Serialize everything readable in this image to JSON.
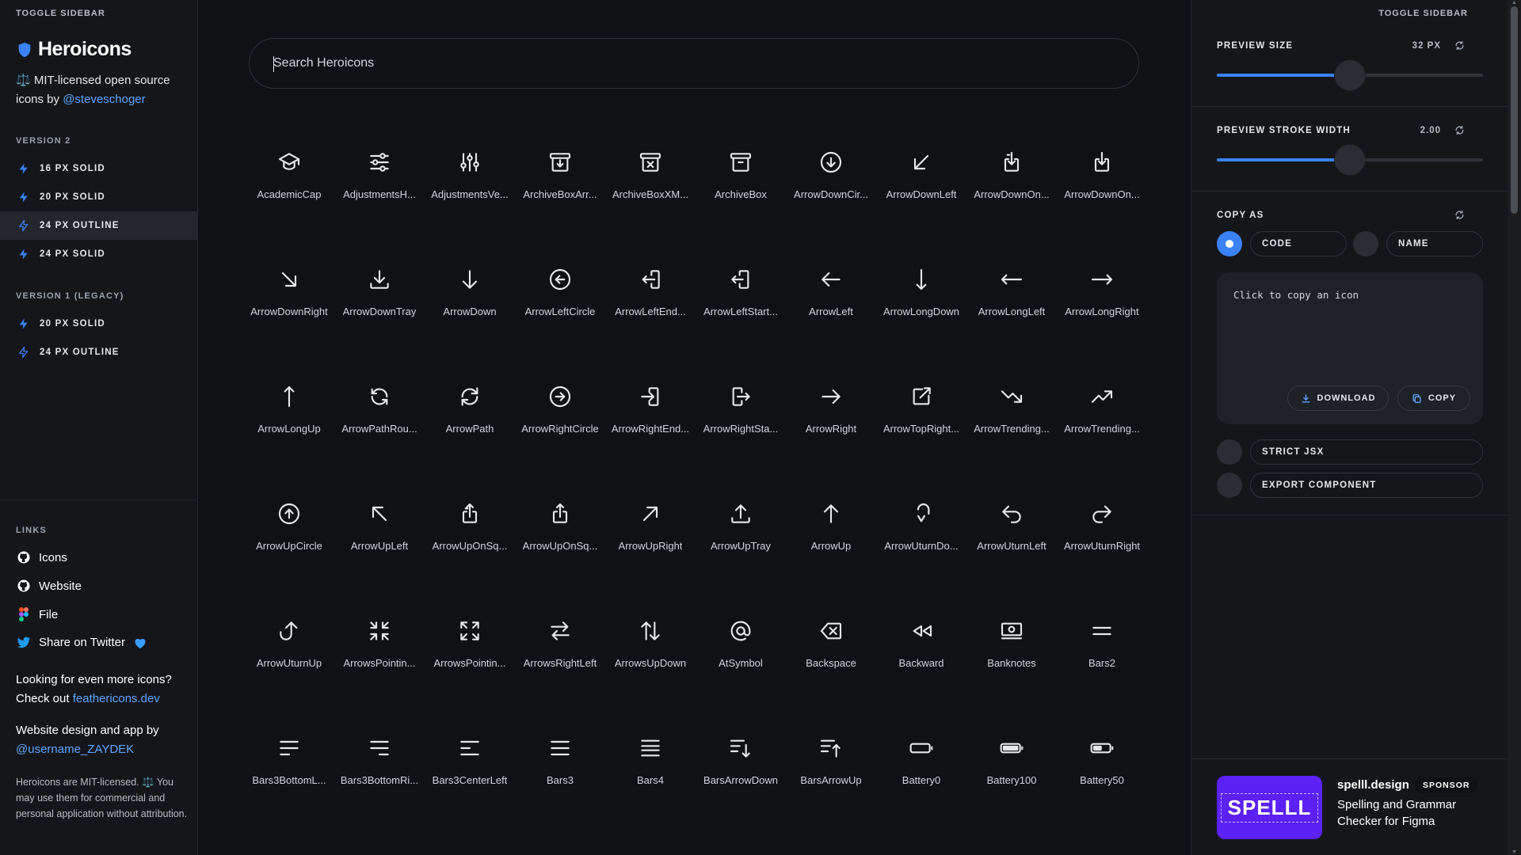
{
  "sidebar": {
    "toggle": "TOGGLE SIDEBAR",
    "brand": "Heroicons",
    "tagline_prefix": "⚖️ MIT-licensed open source icons by ",
    "tagline_link": "@steveschoger",
    "v2_label": "VERSION 2",
    "v2_items": [
      "16 PX SOLID",
      "20 PX SOLID",
      "24 PX OUTLINE",
      "24 PX SOLID"
    ],
    "v1_label": "VERSION 1 (LEGACY)",
    "v1_items": [
      "20 PX SOLID",
      "24 PX OUTLINE"
    ],
    "links_label": "LINKS",
    "links": [
      "Icons",
      "Website",
      "File",
      "Share on Twitter"
    ],
    "promo1_prefix": "Looking for even more icons? Check out ",
    "promo1_link": "feathericons.dev",
    "promo2_prefix": "Website design and app by ",
    "promo2_link": "@username_ZAYDEK",
    "license": "Heroicons are MIT-licensed. ⚖️ You may use them for commercial and personal application without attribution."
  },
  "search": {
    "placeholder": "Search Heroicons"
  },
  "icons": [
    "AcademicCap",
    "AdjustmentsH...",
    "AdjustmentsVe...",
    "ArchiveBoxArr...",
    "ArchiveBoxXM...",
    "ArchiveBox",
    "ArrowDownCir...",
    "ArrowDownLeft",
    "ArrowDownOn...",
    "ArrowDownOn...",
    "ArrowDownRight",
    "ArrowDownTray",
    "ArrowDown",
    "ArrowLeftCircle",
    "ArrowLeftEnd...",
    "ArrowLeftStart...",
    "ArrowLeft",
    "ArrowLongDown",
    "ArrowLongLeft",
    "ArrowLongRight",
    "ArrowLongUp",
    "ArrowPathRou...",
    "ArrowPath",
    "ArrowRightCircle",
    "ArrowRightEnd...",
    "ArrowRightSta...",
    "ArrowRight",
    "ArrowTopRight...",
    "ArrowTrending...",
    "ArrowTrending...",
    "ArrowUpCircle",
    "ArrowUpLeft",
    "ArrowUpOnSq...",
    "ArrowUpOnSq...",
    "ArrowUpRight",
    "ArrowUpTray",
    "ArrowUp",
    "ArrowUturnDo...",
    "ArrowUturnLeft",
    "ArrowUturnRight",
    "ArrowUturnUp",
    "ArrowsPointin...",
    "ArrowsPointin...",
    "ArrowsRightLeft",
    "ArrowsUpDown",
    "AtSymbol",
    "Backspace",
    "Backward",
    "Banknotes",
    "Bars2",
    "Bars3BottomL...",
    "Bars3BottomRi...",
    "Bars3CenterLeft",
    "Bars3",
    "Bars4",
    "BarsArrowDown",
    "BarsArrowUp",
    "Battery0",
    "Battery100",
    "Battery50"
  ],
  "icon_names": [
    "academic-cap-icon",
    "adjustments-horizontal-icon",
    "adjustments-vertical-icon",
    "archive-box-arrow-down-icon",
    "archive-box-x-mark-icon",
    "archive-box-icon",
    "arrow-down-circle-icon",
    "arrow-down-left-icon",
    "arrow-down-on-square-icon",
    "arrow-down-on-square-stack-icon",
    "arrow-down-right-icon",
    "arrow-down-tray-icon",
    "arrow-down-icon",
    "arrow-left-circle-icon",
    "arrow-left-end-on-rectangle-icon",
    "arrow-left-start-on-rectangle-icon",
    "arrow-left-icon",
    "arrow-long-down-icon",
    "arrow-long-left-icon",
    "arrow-long-right-icon",
    "arrow-long-up-icon",
    "arrow-path-rounded-square-icon",
    "arrow-path-icon",
    "arrow-right-circle-icon",
    "arrow-right-end-on-rectangle-icon",
    "arrow-right-start-on-rectangle-icon",
    "arrow-right-icon",
    "arrow-top-right-on-square-icon",
    "arrow-trending-down-icon",
    "arrow-trending-up-icon",
    "arrow-up-circle-icon",
    "arrow-up-left-icon",
    "arrow-up-on-square-icon",
    "arrow-up-on-square-stack-icon",
    "arrow-up-right-icon",
    "arrow-up-tray-icon",
    "arrow-up-icon",
    "arrow-uturn-down-icon",
    "arrow-uturn-left-icon",
    "arrow-uturn-right-icon",
    "arrow-uturn-up-icon",
    "arrows-pointing-in-icon",
    "arrows-pointing-out-icon",
    "arrows-right-left-icon",
    "arrows-up-down-icon",
    "at-symbol-icon",
    "backspace-icon",
    "backward-icon",
    "banknotes-icon",
    "bars-2-icon",
    "bars-3-bottom-left-icon",
    "bars-3-bottom-right-icon",
    "bars-3-center-left-icon",
    "bars-3-icon",
    "bars-4-icon",
    "bars-arrow-down-icon",
    "bars-arrow-up-icon",
    "battery-0-icon",
    "battery-100-icon",
    "battery-50-icon"
  ],
  "panel": {
    "toggle": "TOGGLE SIDEBAR",
    "preview_size_label": "PREVIEW SIZE",
    "preview_size_value": "32 PX",
    "preview_size_fraction": 0.5,
    "stroke_label": "PREVIEW STROKE WIDTH",
    "stroke_value": "2.00",
    "stroke_fraction": 0.5,
    "copy_as_label": "COPY AS",
    "copy_code": "CODE",
    "copy_name": "NAME",
    "copy_hint": "Click to copy an icon",
    "download": "DOWNLOAD",
    "copy": "COPY",
    "strict_jsx": "STRICT JSX",
    "export_component": "EXPORT COMPONENT",
    "sponsor_logo": "SPELLL",
    "sponsor_name": "spelll.design",
    "sponsor_badge": "SPONSOR",
    "sponsor_desc": "Spelling and Grammar Checker for Figma"
  },
  "colors": {
    "accent": "#3b82f6",
    "link": "#60a5fa",
    "background": "#0f1114",
    "sponsor": "#5b21f5"
  }
}
